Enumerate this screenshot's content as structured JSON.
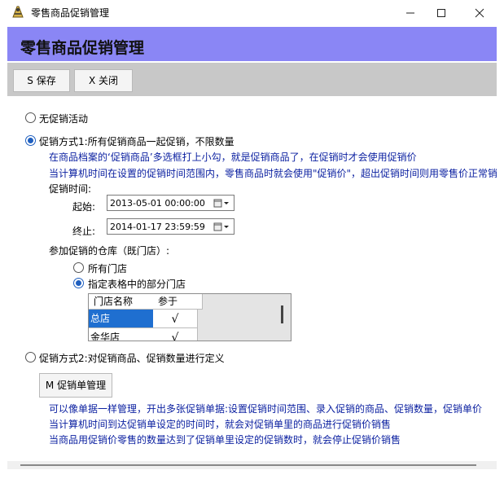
{
  "window": {
    "title": "零售商品促销管理"
  },
  "header": {
    "title": "零售商品促销管理"
  },
  "toolbar": {
    "save_label": "S 保存",
    "close_label": "X 关闭"
  },
  "options": {
    "none_label": "无促销活动",
    "mode1_label": "促销方式1:所有促销商品一起促销，不限数量",
    "mode1_desc1": "在商品档案的‘促销商品’多选框打上小勾，就是促销商品了，在促销时才会使用促销价",
    "mode1_desc2": "当计算机时间在设置的促销时间范围内，零售商品时就会使用\"促销价\"，超出促销时间则用零售价正常销",
    "period_label": "促销时间:",
    "start_label": "起始:",
    "start_value": "2013-05-01 00:00:00",
    "end_label": "终止:",
    "end_value": "2014-01-17 23:59:59",
    "warehouse_label": "参加促销的仓库（既门店）:",
    "all_stores_label": "所有门店",
    "selected_stores_label": "指定表格中的部分门店",
    "grid": {
      "headers": [
        "门店名称",
        "参于"
      ],
      "rows": [
        {
          "name": "总店",
          "check": "√"
        },
        {
          "name": "金华店",
          "check": "√"
        }
      ]
    },
    "mode2_label": "促销方式2:对促销商品、促销数量进行定义",
    "promo_button_label": "M 促销单管理",
    "mode2_desc1": "可以像单据一样管理，开出多张促销单据:设置促销时间范围、录入促销的商品、促销数量，促销单价",
    "mode2_desc2": "当计算机时间到达促销单设定的时间时，就会对促销单里的商品进行促销价销售",
    "mode2_desc3": "当商品用促销价零售的数量达到了促销单里设定的促销数时，就会停止促销价销售"
  },
  "colors": {
    "header_band": "#8a86f5",
    "description_text": "#0a1fa0",
    "selection": "#1f6fd0"
  }
}
